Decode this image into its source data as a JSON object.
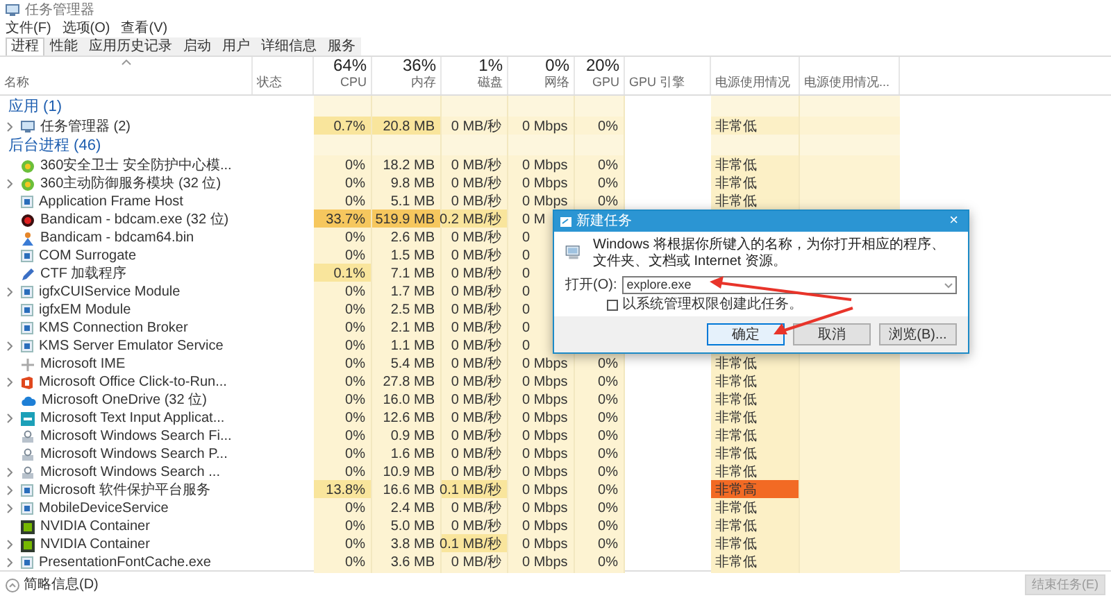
{
  "window": {
    "title": "任务管理器"
  },
  "menu": [
    "文件(F)",
    "选项(O)",
    "查看(V)"
  ],
  "tabs": [
    {
      "label": "进程",
      "selected": true
    },
    {
      "label": "性能",
      "selected": false
    },
    {
      "label": "应用历史记录",
      "selected": false
    },
    {
      "label": "启动",
      "selected": false
    },
    {
      "label": "用户",
      "selected": false
    },
    {
      "label": "详细信息",
      "selected": false
    },
    {
      "label": "服务",
      "selected": false
    }
  ],
  "columns": [
    {
      "label": "名称",
      "sorted": true
    },
    {
      "label": "状态",
      "sorted": false
    },
    {
      "percent": "64%",
      "label": "CPU",
      "sorted": false
    },
    {
      "percent": "36%",
      "label": "内存",
      "sorted": false
    },
    {
      "percent": "1%",
      "label": "磁盘",
      "sorted": false
    },
    {
      "percent": "0%",
      "label": "网络",
      "sorted": false
    },
    {
      "percent": "20%",
      "label": "GPU",
      "sorted": false
    },
    {
      "label": "GPU 引擎",
      "sorted": false
    },
    {
      "label": "电源使用情况",
      "sorted": false
    },
    {
      "label": "电源使用情况...",
      "sorted": false
    }
  ],
  "sections": [
    {
      "title": "应用 (1)",
      "rows": [
        {
          "name": "任务管理器 (2)",
          "expandable": true,
          "cpu": "0.7%",
          "memory": "20.8 MB",
          "disk": "0 MB/秒",
          "network": "0 Mbps",
          "gpu": "0%",
          "power": "非常低",
          "hot": {
            "cpu": {
              "color": "#f9e59c"
            },
            "memory": {
              "color": "#f9e59c"
            }
          }
        }
      ]
    },
    {
      "title": "后台进程 (46)",
      "rows": [
        {
          "name": "360安全卫士 安全防护中心模...",
          "expandable": false,
          "cpu": "0%",
          "memory": "18.2 MB",
          "disk": "0 MB/秒",
          "network": "0 Mbps",
          "gpu": "0%",
          "power": "非常低"
        },
        {
          "name": "360主动防御服务模块 (32 位)",
          "expandable": true,
          "cpu": "0%",
          "memory": "9.8 MB",
          "disk": "0 MB/秒",
          "network": "0 Mbps",
          "gpu": "0%",
          "power": "非常低"
        },
        {
          "name": "Application Frame Host",
          "expandable": false,
          "cpu": "0%",
          "memory": "5.1 MB",
          "disk": "0 MB/秒",
          "network": "0 Mbps",
          "gpu": "0%",
          "power": "非常低"
        },
        {
          "name": "Bandicam - bdcam.exe (32 位)",
          "expandable": false,
          "cpu": "33.7%",
          "memory": "519.9 MB",
          "disk": "0.2 MB/秒",
          "network": "0 M",
          "hot": {
            "cpu": {
              "color": "#f6c75e"
            },
            "memory": {
              "color": "#f6c75e"
            },
            "disk": {
              "color": "#f9e59c"
            }
          }
        },
        {
          "name": "Bandicam - bdcam64.bin",
          "expandable": false,
          "cpu": "0%",
          "memory": "2.6 MB",
          "disk": "0 MB/秒",
          "network": "0"
        },
        {
          "name": "COM Surrogate",
          "expandable": false,
          "cpu": "0%",
          "memory": "1.5 MB",
          "disk": "0 MB/秒",
          "network": "0"
        },
        {
          "name": "CTF 加载程序",
          "expandable": false,
          "cpu": "0.1%",
          "memory": "7.1 MB",
          "disk": "0 MB/秒",
          "network": "0",
          "hot": {
            "cpu": {
              "color": "#f9e59c"
            }
          }
        },
        {
          "name": "igfxCUIService Module",
          "expandable": true,
          "cpu": "0%",
          "memory": "1.7 MB",
          "disk": "0 MB/秒",
          "network": "0"
        },
        {
          "name": "igfxEM Module",
          "expandable": false,
          "cpu": "0%",
          "memory": "2.5 MB",
          "disk": "0 MB/秒",
          "network": "0"
        },
        {
          "name": "KMS Connection Broker",
          "expandable": false,
          "cpu": "0%",
          "memory": "2.1 MB",
          "disk": "0 MB/秒",
          "network": "0"
        },
        {
          "name": "KMS Server Emulator Service",
          "expandable": true,
          "cpu": "0%",
          "memory": "1.1 MB",
          "disk": "0 MB/秒",
          "network": "0"
        },
        {
          "name": "Microsoft IME",
          "expandable": false,
          "cpu": "0%",
          "memory": "5.4 MB",
          "disk": "0 MB/秒",
          "network": "0 Mbps",
          "gpu": "0%",
          "power": "非常低"
        },
        {
          "name": "Microsoft Office Click-to-Run...",
          "expandable": true,
          "cpu": "0%",
          "memory": "27.8 MB",
          "disk": "0 MB/秒",
          "network": "0 Mbps",
          "gpu": "0%",
          "power": "非常低"
        },
        {
          "name": "Microsoft OneDrive (32 位)",
          "expandable": false,
          "cpu": "0%",
          "memory": "16.0 MB",
          "disk": "0 MB/秒",
          "network": "0 Mbps",
          "gpu": "0%",
          "power": "非常低"
        },
        {
          "name": "Microsoft Text Input Applicat...",
          "expandable": true,
          "cpu": "0%",
          "memory": "12.6 MB",
          "disk": "0 MB/秒",
          "network": "0 Mbps",
          "gpu": "0%",
          "power": "非常低"
        },
        {
          "name": "Microsoft Windows Search Fi...",
          "expandable": false,
          "cpu": "0%",
          "memory": "0.9 MB",
          "disk": "0 MB/秒",
          "network": "0 Mbps",
          "gpu": "0%",
          "power": "非常低"
        },
        {
          "name": "Microsoft Windows Search P...",
          "expandable": false,
          "cpu": "0%",
          "memory": "1.6 MB",
          "disk": "0 MB/秒",
          "network": "0 Mbps",
          "gpu": "0%",
          "power": "非常低"
        },
        {
          "name": "Microsoft Windows Search ...",
          "expandable": true,
          "cpu": "0%",
          "memory": "10.9 MB",
          "disk": "0 MB/秒",
          "network": "0 Mbps",
          "gpu": "0%",
          "power": "非常低"
        },
        {
          "name": "Microsoft 软件保护平台服务",
          "expandable": true,
          "cpu": "13.8%",
          "memory": "16.6 MB",
          "disk": "0.1 MB/秒",
          "network": "0 Mbps",
          "gpu": "0%",
          "power": "非常高",
          "hot": {
            "cpu": {
              "color": "#f9e59c"
            },
            "disk": {
              "color": "#f9e59c"
            },
            "power": {
              "color": "#f26a24"
            }
          }
        },
        {
          "name": "MobileDeviceService",
          "expandable": true,
          "cpu": "0%",
          "memory": "2.4 MB",
          "disk": "0 MB/秒",
          "network": "0 Mbps",
          "gpu": "0%",
          "power": "非常低"
        },
        {
          "name": "NVIDIA Container",
          "expandable": false,
          "cpu": "0%",
          "memory": "5.0 MB",
          "disk": "0 MB/秒",
          "network": "0 Mbps",
          "gpu": "0%",
          "power": "非常低"
        },
        {
          "name": "NVIDIA Container",
          "expandable": true,
          "cpu": "0%",
          "memory": "3.8 MB",
          "disk": "0.1 MB/秒",
          "network": "0 Mbps",
          "gpu": "0%",
          "power": "非常低",
          "hot": {
            "disk": {
              "color": "#f9e59c"
            }
          }
        },
        {
          "name": "PresentationFontCache.exe",
          "expandable": true,
          "cpu": "0%",
          "memory": "3.6 MB",
          "disk": "0 MB/秒",
          "network": "0 Mbps",
          "gpu": "0%",
          "power": "非常低"
        }
      ]
    }
  ],
  "footer": {
    "label": "简略信息(D)",
    "end_task": {
      "label": "结束任务(E)",
      "disabled": true
    }
  },
  "dialog": {
    "title": "新建任务",
    "close": "×",
    "message": "Windows 将根据你所键入的名称，为你打开相应的程序、文件夹、文档或 Internet 资源。",
    "open_label": "打开(O):",
    "open_value": "explore.exe",
    "admin_checkbox": {
      "label": "以系统管理权限创建此任务。",
      "checked": false
    },
    "buttons": [
      {
        "label": "确定",
        "selected": true
      },
      {
        "label": "取消",
        "selected": false
      },
      {
        "label": "浏览(B)...",
        "selected": false
      }
    ]
  }
}
